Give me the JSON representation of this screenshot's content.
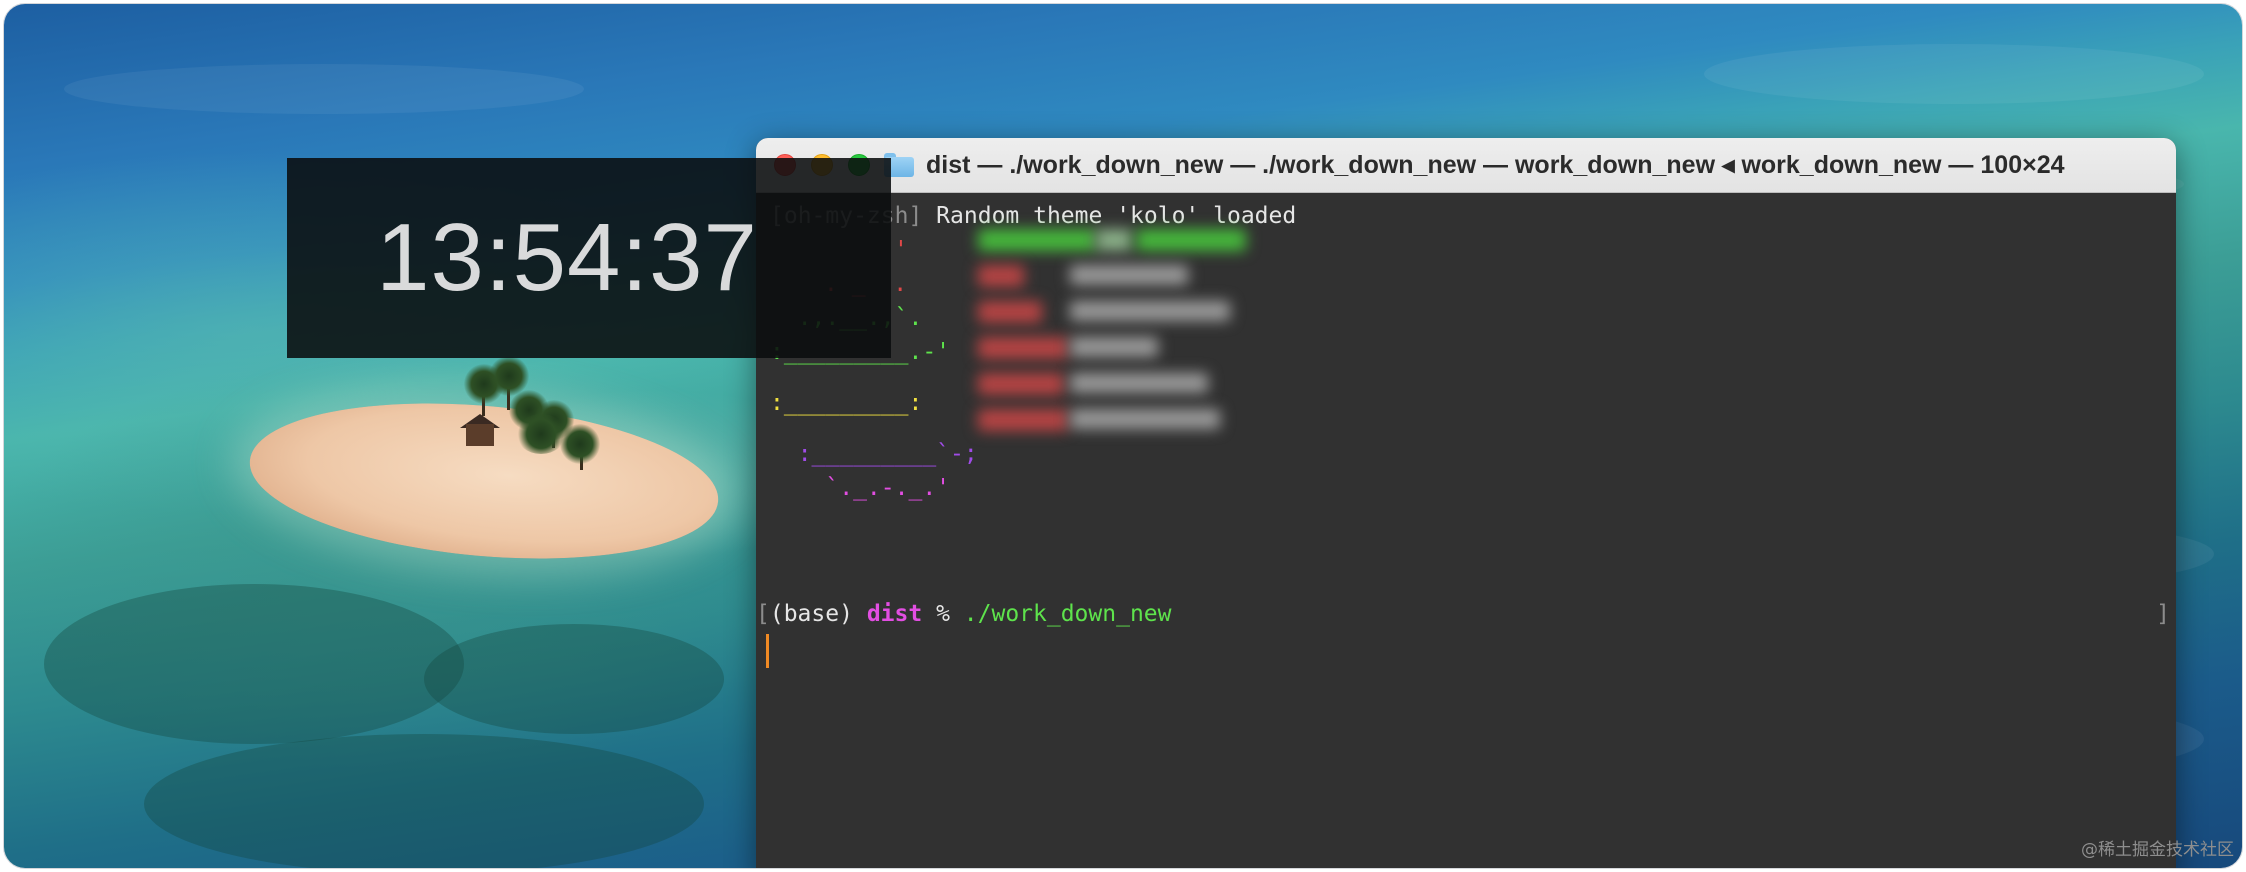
{
  "clock": {
    "time": "13:54:37"
  },
  "terminal": {
    "title": "dist — ./work_down_new — ./work_down_new — work_down_new ◂ work_down_new — 100×24",
    "folder_icon": "folder-icon",
    "theme_line": {
      "prefix": "[oh-my-zsh]",
      "message": " Random theme 'kolo' loaded"
    },
    "prompt": {
      "env": "(base)",
      "dir": "dist",
      "symbol": "%",
      "command": "./work_down_new"
    }
  },
  "colors": {
    "terminal_bg": "#313131",
    "prompt_dir": "#e24ee2",
    "command": "#5ee34c",
    "cursor": "#f08a24"
  },
  "watermark": "@稀土掘金技术社区"
}
